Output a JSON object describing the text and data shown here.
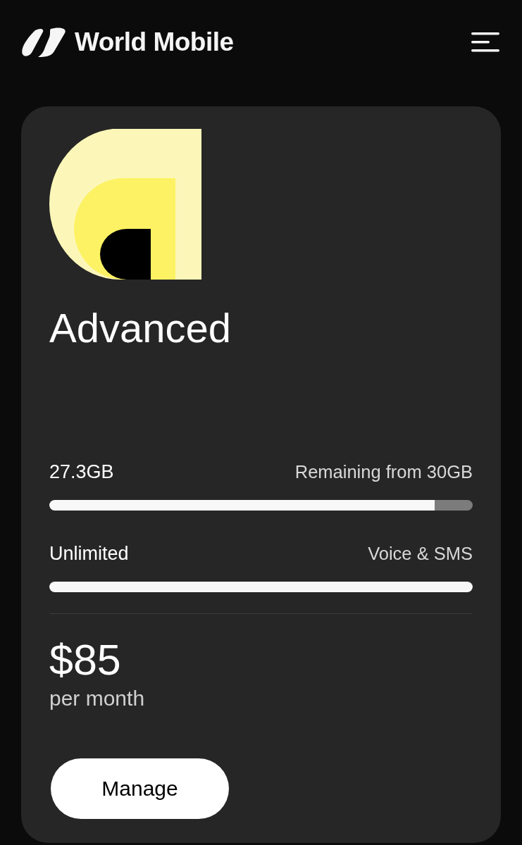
{
  "header": {
    "brand": "World Mobile"
  },
  "plan": {
    "name": "Advanced",
    "allowances": [
      {
        "amount": "27.3GB",
        "caption": "Remaining from 30GB",
        "level": 0.91
      },
      {
        "amount": "Unlimited",
        "caption": "Voice & SMS",
        "level": 1
      }
    ],
    "price": "$85",
    "period": "per month",
    "button": "Manage"
  }
}
